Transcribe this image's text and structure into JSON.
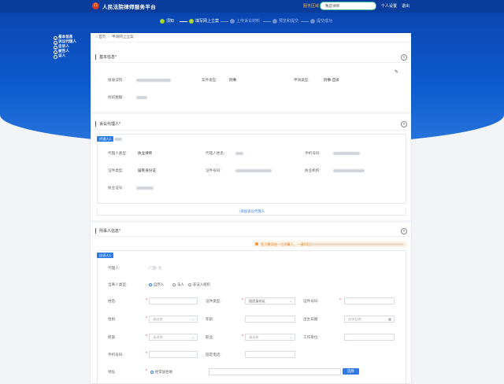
{
  "header": {
    "app_title": "人民法院律师服务平台",
    "region_label": "服务区域",
    "region_value": "我是律师",
    "personal_center": "个人设置",
    "logout": "退出"
  },
  "steps": [
    {
      "label": "须知",
      "status": "done"
    },
    {
      "label": "填写网上立案",
      "status": "done"
    },
    {
      "label": "上传诉讼材料",
      "status": "todo"
    },
    {
      "label": "预览和提交",
      "status": "todo"
    },
    {
      "label": "提交成功",
      "status": "todo"
    }
  ],
  "left_nav": [
    "基本信息",
    "诉讼代理人",
    "自诉人",
    "被告人",
    "证人"
  ],
  "breadcrumb": {
    "home": "首页",
    "current": "申请网上立案"
  },
  "basic_info": {
    "title": "基本信息*",
    "court_label": "接收法院:",
    "case_type_label": "案件类型:",
    "case_type_value": "刑事",
    "apply_type_label": "申请类型:",
    "apply_type_value": "刑事-自诉",
    "amount_label": "标的数额:"
  },
  "agent": {
    "title": "诉讼代理人*",
    "tag": "代理人1",
    "type_label": "代理人类型:",
    "type_value": "执业律师",
    "name_label": "代理人姓名:",
    "phone_label": "手机号码:",
    "id_type_label": "证件类型:",
    "id_type_value": "居民身份证",
    "id_no_label": "证件号码:",
    "firm_label": "执业机构:",
    "license_label": "执业证号:",
    "add_link": "+添加诉讼代理人"
  },
  "plaintiff": {
    "title": "刑事人信息*",
    "notice": "您只需添加一位刑事人，一键代理人",
    "tag": "自诉人1",
    "agent_label": "代理人:",
    "agent_toggle": "否",
    "party_type_label": "当事人类型:",
    "party_types": [
      "自然人",
      "法人",
      "非法人组织"
    ],
    "name_label": "姓名:",
    "cert_type_label": "证件类型:",
    "cert_type_value": "居民身份证",
    "cert_no_label": "证件号码:",
    "gender_label": "性别:",
    "gender_placeholder": "请选择",
    "age_label": "年龄:",
    "birth_label": "出生日期:",
    "birth_placeholder": "选择日期",
    "ethnic_label": "民族:",
    "ethnic_placeholder": "请选择",
    "job_label": "职业:",
    "job_placeholder": "请选择",
    "work_label": "工作单位:",
    "phone_label": "手机号码:",
    "landline_label": "固定电话:",
    "address_label": "地址:",
    "address_option": "经常居住地",
    "address_button": "选择"
  }
}
